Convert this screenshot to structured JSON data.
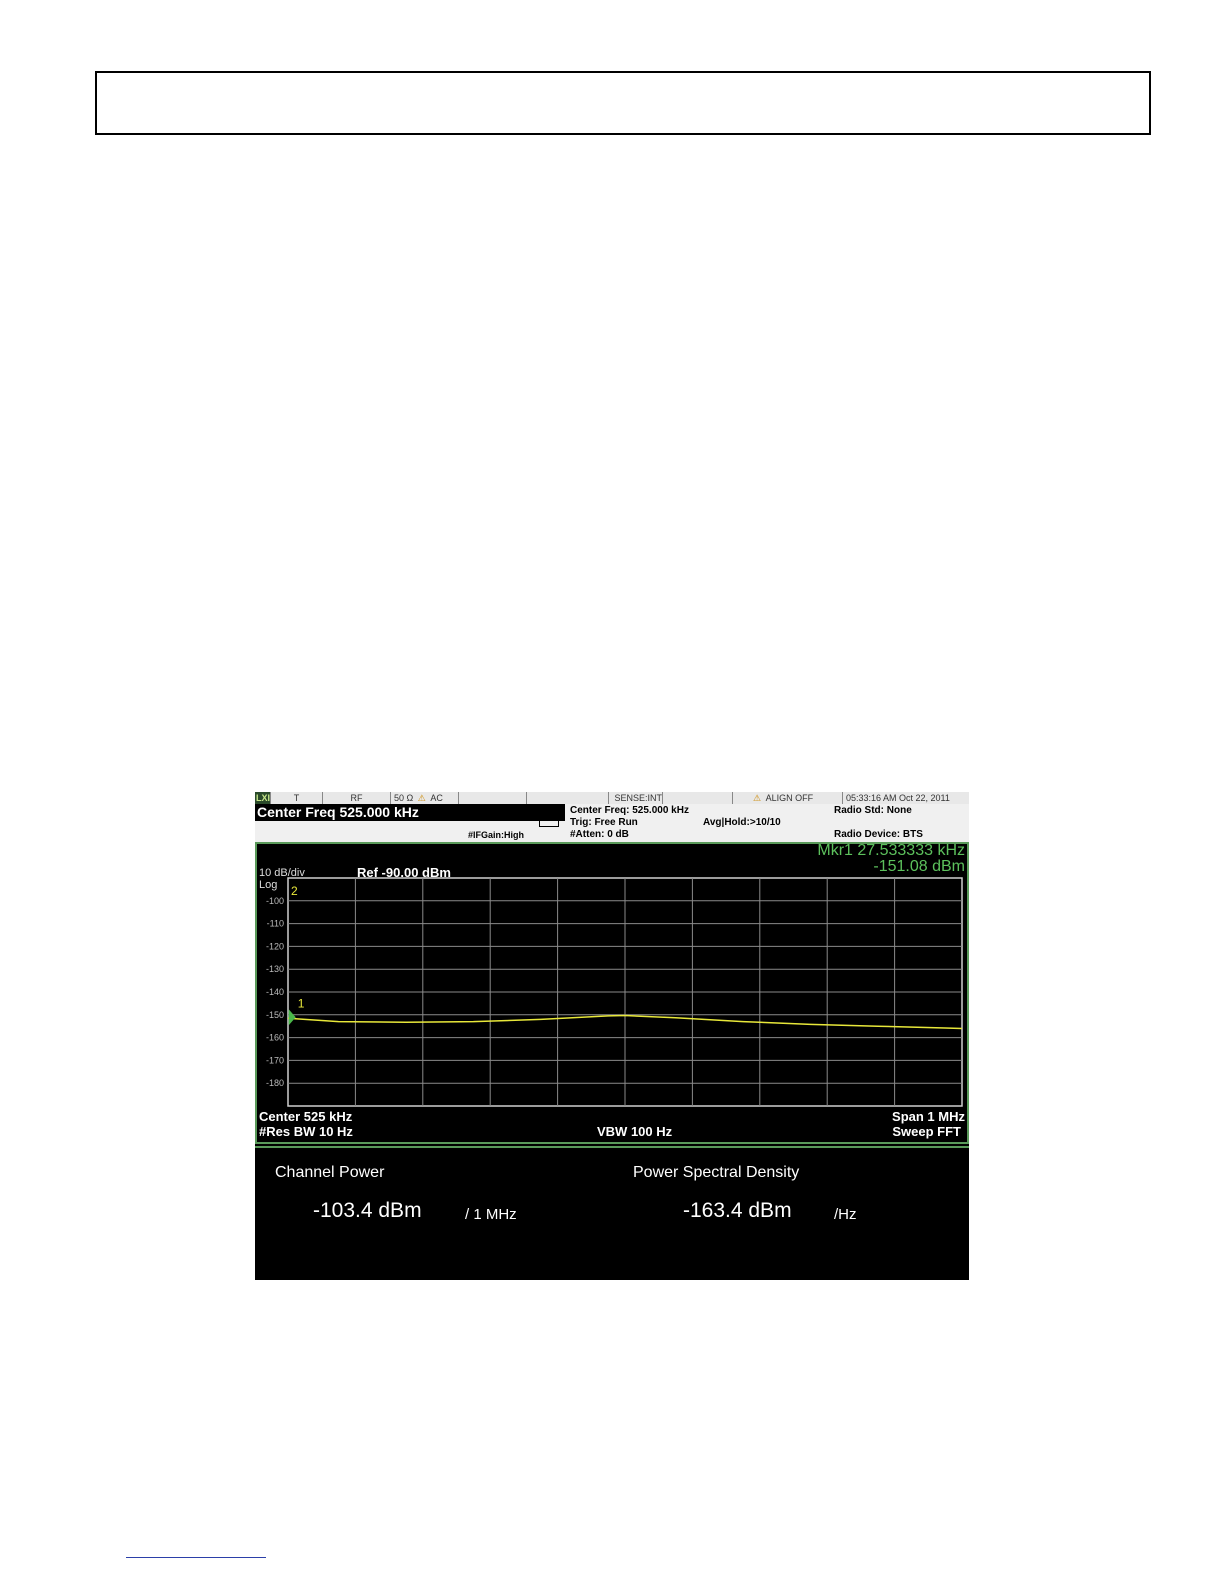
{
  "status_bar": {
    "lxi": "LXI",
    "t": "T",
    "rf": "RF",
    "impedance": "50 Ω",
    "ac": "AC",
    "sense": "SENSE:INT",
    "align": "ALIGN OFF",
    "timestamp": "05:33:16 AM Oct 22, 2011"
  },
  "info_bar": {
    "center_freq_title": "Center Freq  525.000 kHz",
    "if_gain": "#IFGain:High",
    "center_freq": "Center Freq: 525.000 kHz",
    "trig": "Trig: Free Run",
    "atten": "#Atten: 0 dB",
    "avg_hold": "Avg|Hold:>10/10",
    "radio_std": "Radio Std: None",
    "radio_device": "Radio Device: BTS"
  },
  "display": {
    "scale": "10 dB/div",
    "log": "Log",
    "ref": "Ref -90.00 dBm",
    "marker_freq": "Mkr1  27.533333 kHz",
    "marker_amp": "-151.08 dBm",
    "marker1_label": "1",
    "marker2_label": "2",
    "center": "Center  525 kHz",
    "res_bw": "#Res BW  10 Hz",
    "vbw": "VBW  100 Hz",
    "span": "Span 1 MHz",
    "sweep": "Sweep FFT"
  },
  "results": {
    "channel_power_label": "Channel Power",
    "channel_power_value": "-103.4 dBm",
    "channel_power_unit": "/ 1 MHz",
    "psd_label": "Power Spectral Density",
    "psd_value": "-163.4 dBm",
    "psd_unit": "/Hz"
  },
  "chart_data": {
    "type": "line",
    "xlim": [
      25000,
      1025000
    ],
    "ylim": [
      -190,
      -90
    ],
    "y_ticks": [
      "-100",
      "-110",
      "-120",
      "-130",
      "-140",
      "-150",
      "-160",
      "-170",
      "-180"
    ],
    "grid": true,
    "trace_color": "#e8e83a",
    "grid_color": "#8a8a8a",
    "series": [
      {
        "x": [
          25000,
          100000,
          200000,
          300000,
          400000,
          500000,
          525000,
          600000,
          700000,
          800000,
          900000,
          1000000,
          1025000
        ],
        "values": [
          -151.5,
          -153.0,
          -153.3,
          -153.0,
          -152.0,
          -150.5,
          -150.3,
          -151.3,
          -153.0,
          -154.2,
          -155.0,
          -155.8,
          -156.0
        ]
      }
    ],
    "markers": [
      {
        "label": "1",
        "x": 27533,
        "y": -151.08
      }
    ]
  }
}
